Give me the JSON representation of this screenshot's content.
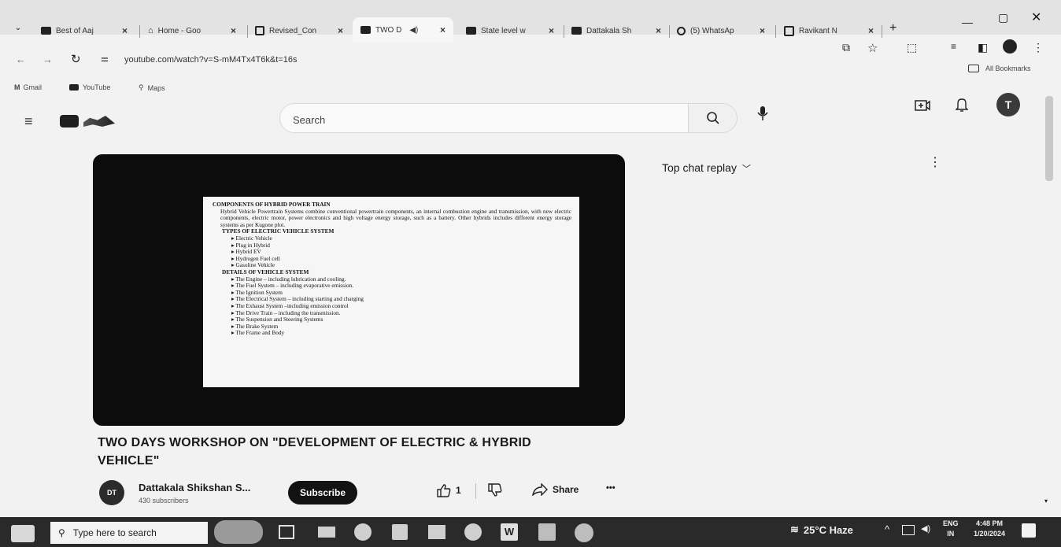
{
  "browser": {
    "tabs": [
      {
        "label": "Best of Aaj"
      },
      {
        "label": "Home - Goo"
      },
      {
        "label": "Revised_Con"
      },
      {
        "label": "TWO D"
      },
      {
        "label": "State level w"
      },
      {
        "label": "Dattakala Sh"
      },
      {
        "label": "(5) WhatsAp"
      },
      {
        "label": "Ravikant N"
      }
    ],
    "new_tab": "+",
    "url": "youtube.com/watch?v=S-mM4Tx4T6k&t=16s",
    "all_bookmarks": "All Bookmarks",
    "bookmarks": [
      {
        "label": "Gmail"
      },
      {
        "label": "YouTube"
      },
      {
        "label": "Maps"
      }
    ]
  },
  "youtube": {
    "search_placeholder": "Search",
    "avatar_letter": "T",
    "chat_header": "Top chat replay",
    "video_title_line1": "TWO DAYS WORKSHOP ON \"DEVELOPMENT OF ELECTRIC & HYBRID",
    "video_title_line2": "VEHICLE\"",
    "channel_name": "Dattakala Shikshan S...",
    "channel_avatar_text": "DT",
    "subscribers": "430 subscribers",
    "subscribe_label": "Subscribe",
    "like_count": "1",
    "share_label": "Share",
    "more_label": "•••"
  },
  "slide": {
    "h1": "COMPONENTS OF HYBRID POWER TRAIN",
    "p1": "Hybrid Vehicle Powertrain Systems combine conventional powertrain components, an internal combustion engine and transmission, with new electric components, electric motor, power electronics and high voltage energy storage, such as a battery. Other hybrids includes different energy storage systems as per Kugone plot.",
    "h2": "TYPES OF ELECTRIC VEHICLE SYSTEM",
    "types": [
      "Electric Vehicle",
      "Plug in Hybrid",
      "Hybrid EV",
      "Hydrogen Fuel cell",
      "Gasoline Vehicle"
    ],
    "h3": "DETAILS OF VEHICLE SYSTEM",
    "details": [
      "The Engine – including lubrication and cooling.",
      "The Fuel System – including evaporative emission.",
      "The Ignition System",
      "The Electrical System – including starting and charging",
      "The Exhaust System –including emission control",
      "The Drive Train – including the transmission.",
      "The Suspension and Steering Systems",
      "The Brake System",
      "The Frame and Body"
    ]
  },
  "taskbar": {
    "search_placeholder": "Type here to search",
    "weather": "25°C Haze",
    "lang_top": "ENG",
    "lang_bottom": "IN",
    "time": "4:48 PM",
    "date": "1/20/2024"
  }
}
